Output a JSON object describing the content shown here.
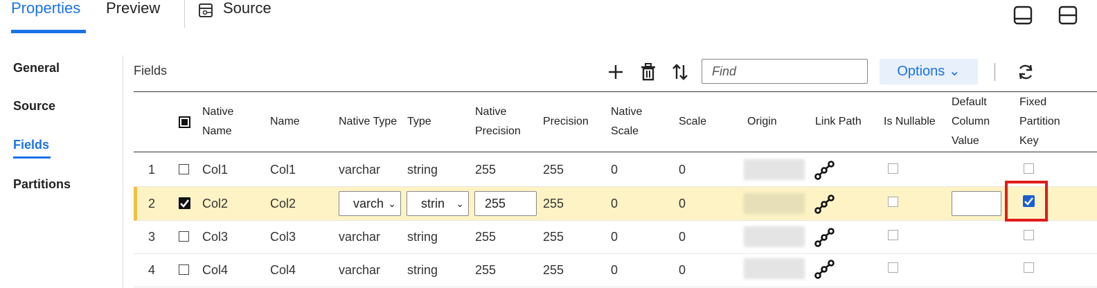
{
  "tabs": {
    "properties": "Properties",
    "preview": "Preview",
    "source": "Source"
  },
  "sidebar": {
    "items": [
      "General",
      "Source",
      "Fields",
      "Partitions"
    ]
  },
  "toolbar": {
    "fields_label": "Fields",
    "find_placeholder": "Find",
    "options_label": "Options ⌄"
  },
  "columns": {
    "native_name": [
      "Native",
      "Name"
    ],
    "name": "Name",
    "native_type": "Native Type",
    "type": "Type",
    "native_precision": [
      "Native",
      "Precision"
    ],
    "precision": "Precision",
    "native_scale": [
      "Native",
      "Scale"
    ],
    "scale": "Scale",
    "origin": "Origin",
    "link_path": "Link Path",
    "is_nullable": "Is Nullable",
    "default_value": [
      "Default",
      "Column",
      "Value"
    ],
    "fixed_partition": [
      "Fixed",
      "Partition",
      "Key"
    ]
  },
  "rows": [
    {
      "num": "1",
      "native_name": "Col1",
      "name": "Col1",
      "native_type": "varchar",
      "type": "string",
      "native_precision": "255",
      "precision": "255",
      "native_scale": "0",
      "scale": "0"
    },
    {
      "num": "2",
      "native_name": "Col2",
      "name": "Col2",
      "native_type": "varch",
      "type": "strin",
      "native_precision": "255",
      "precision": "255",
      "native_scale": "0",
      "scale": "0"
    },
    {
      "num": "3",
      "native_name": "Col3",
      "name": "Col3",
      "native_type": "varchar",
      "type": "string",
      "native_precision": "255",
      "precision": "255",
      "native_scale": "0",
      "scale": "0"
    },
    {
      "num": "4",
      "native_name": "Col4",
      "name": "Col4",
      "native_type": "varchar",
      "type": "string",
      "native_precision": "255",
      "precision": "255",
      "native_scale": "0",
      "scale": "0"
    }
  ],
  "colors": {
    "accent": "#1a73e8",
    "selected_row": "#fdf3c4",
    "highlight_box": "#e01b1b"
  }
}
